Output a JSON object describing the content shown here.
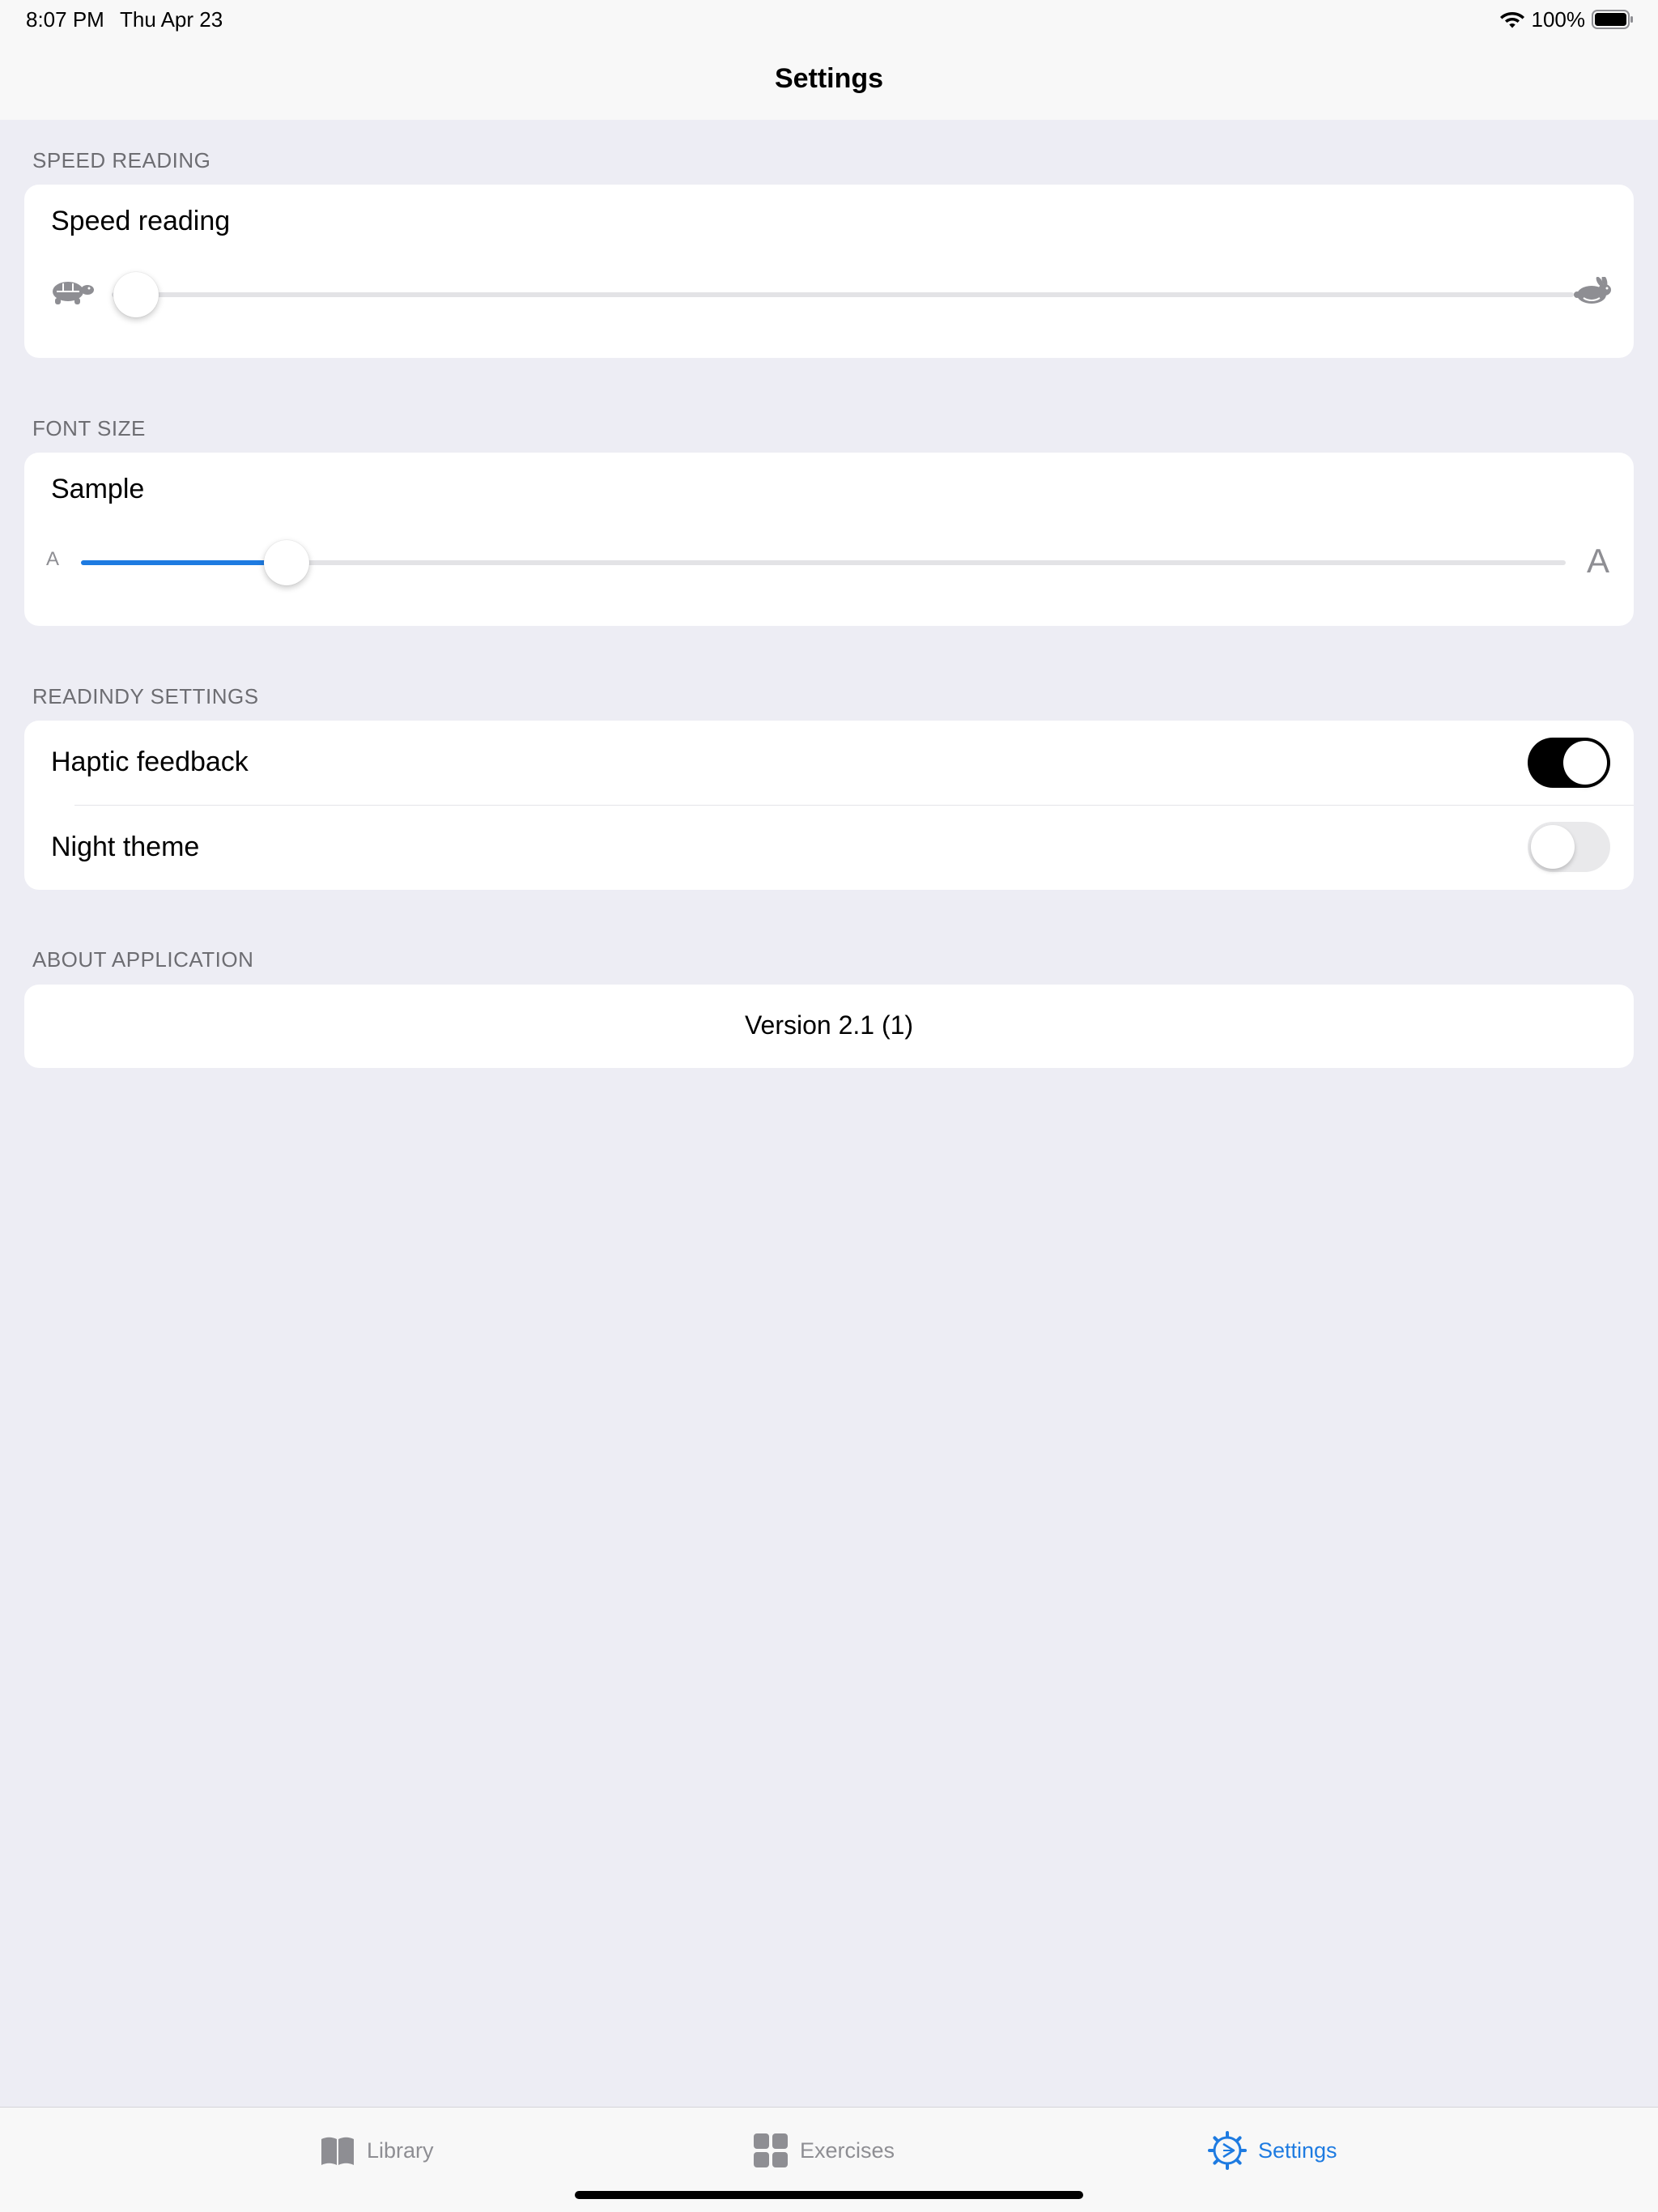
{
  "status": {
    "time": "8:07 PM",
    "date": "Thu Apr 23",
    "battery": "100%"
  },
  "nav": {
    "title": "Settings"
  },
  "sections": {
    "speed_reading": {
      "header": "SPEED READING",
      "label": "Speed reading",
      "slider_value": 0,
      "min_icon": "turtle-icon",
      "max_icon": "rabbit-icon"
    },
    "font_size": {
      "header": "FONT SIZE",
      "label": "Sample",
      "slider_value": 0.127,
      "min_label": "A",
      "max_label": "A"
    },
    "readindy_settings": {
      "header": "READINDY SETTINGS",
      "items": [
        {
          "label": "Haptic feedback",
          "on": true
        },
        {
          "label": "Night theme",
          "on": false
        }
      ]
    },
    "about": {
      "header": "ABOUT APPLICATION",
      "version": "Version 2.1 (1)"
    }
  },
  "tabs": [
    {
      "label": "Library",
      "icon": "book-icon",
      "active": false
    },
    {
      "label": "Exercises",
      "icon": "grid-icon",
      "active": false
    },
    {
      "label": "Settings",
      "icon": "gear-icon",
      "active": true
    }
  ],
  "colors": {
    "accent": "#1E7BE1",
    "inactive_tab": "#8E8E93",
    "background": "#EDEDF4",
    "toggle_on": "#000000",
    "toggle_off": "#E9E9EB"
  }
}
